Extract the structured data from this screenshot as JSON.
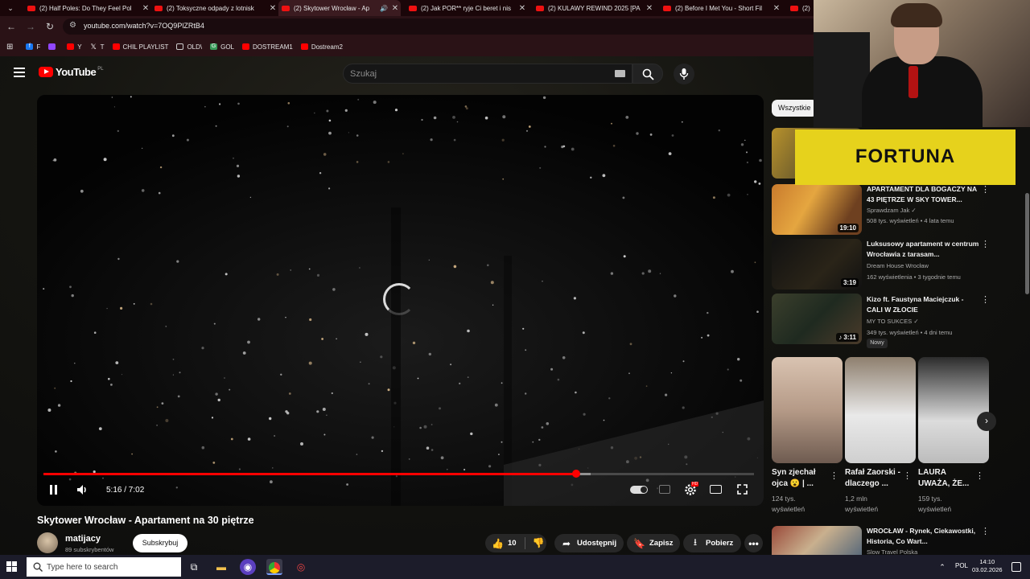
{
  "tabs": [
    {
      "title": "(2) Half Poles: Do They Feel Pol"
    },
    {
      "title": "(2) Toksyczne odpady z lotnisk"
    },
    {
      "title": "(2) Skytower Wrocław - Ap"
    },
    {
      "title": "(2) Jak POR** ryje Ci beret i nis"
    },
    {
      "title": "(2) KULAWY REWIND 2025 [PA"
    },
    {
      "title": "(2) Before I Met You - Short Fil"
    },
    {
      "title": "(2)"
    }
  ],
  "address": {
    "url": "youtube.com/watch?v=7OQ9PlZRtB4"
  },
  "bookmarks": [
    {
      "label": "F",
      "icon": "facebook-icon"
    },
    {
      "label": "",
      "icon": "twitch-icon"
    },
    {
      "label": "Y",
      "icon": "youtube-icon"
    },
    {
      "label": "T",
      "icon": "x-icon"
    },
    {
      "label": "CHIL PLAYLIST",
      "icon": "youtube-icon"
    },
    {
      "label": "OLD\\",
      "icon": "folder-icon"
    },
    {
      "label": "GOL",
      "icon": "gol-icon"
    },
    {
      "label": "DOSTREAM1",
      "icon": "youtube-icon"
    },
    {
      "label": "Dostream2",
      "icon": "youtube-icon"
    }
  ],
  "youtube": {
    "logo": "YouTube",
    "country": "PL",
    "search_placeholder": "Szukaj"
  },
  "player": {
    "time": "5:16 / 7:02",
    "progress": 0.75,
    "buffered": 0.77
  },
  "video": {
    "title": "Skytower Wrocław - Apartament na 30 piętrze",
    "channel": "matijacy",
    "subs": "89 subskrybentów",
    "subscribe": "Subskrybuj",
    "likes": "10",
    "share": "Udostępnij",
    "save": "Zapisz",
    "download": "Pobierz"
  },
  "sidebar": {
    "chip": "Wszystkie",
    "ad": {
      "text": "FORTUNA"
    },
    "videos": [
      {
        "title": "APARTAMENT DLA BOGACZY NA 43 PIĘTRZE W SKY TOWER...",
        "channel": "Sprawdzam Jak ✓",
        "meta": "508 tys. wyświetleń • 4 lata temu",
        "duration": "19:10"
      },
      {
        "title": "Luksusowy apartament w centrum Wrocławia z tarasam...",
        "channel": "Dream House Wrocław",
        "meta": "162 wyświetlenia • 3 tygodnie temu",
        "duration": "3:19"
      },
      {
        "title": "Kizo ft. Faustyna Maciejczuk - CALI W ZŁOCIE",
        "channel": "MY TO SUKCES ✓",
        "meta": "349 tys. wyświetleń • 4 dni temu",
        "duration": "♪ 3:11",
        "badge": "Nowy"
      },
      {
        "title": "WROCŁAW - Rynek, Ciekawostki, Historia, Co Wart...",
        "channel": "Slow Travel Polska",
        "meta": "",
        "duration": ""
      }
    ],
    "shorts": [
      {
        "title": "Syn zjechał ojca 😮 | ...",
        "views": "124 tys. wyświetleń"
      },
      {
        "title": "Rafał Zaorski - dlaczego ...",
        "views": "1,2 mln wyświetleń"
      },
      {
        "title": "LAURA UWAŻA, ŻE...",
        "views": "159 tys. wyświetleń"
      }
    ]
  },
  "taskbar": {
    "search_placeholder": "Type here to search",
    "lang": "POL",
    "time": "14:10",
    "date": "03.02.2026"
  }
}
